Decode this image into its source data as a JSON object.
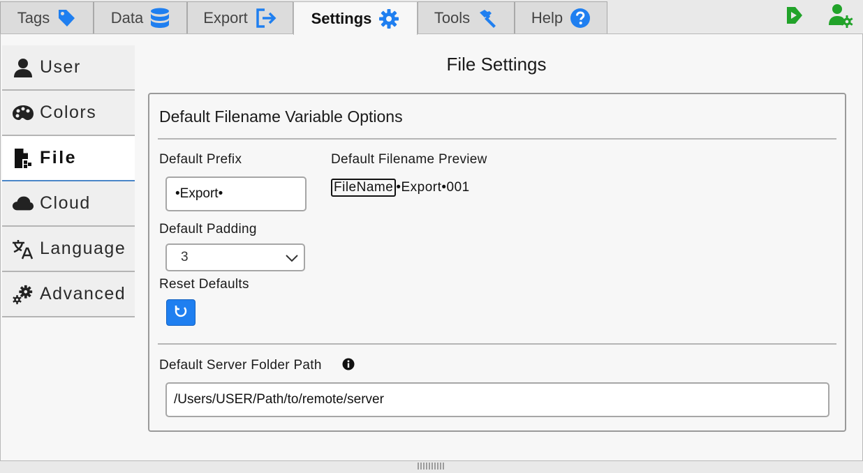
{
  "tabs": [
    {
      "label": "Tags",
      "icon": "tag-icon"
    },
    {
      "label": "Data",
      "icon": "database-icon"
    },
    {
      "label": "Export",
      "icon": "export-icon"
    },
    {
      "label": "Settings",
      "icon": "gear-icon",
      "active": true
    },
    {
      "label": "Tools",
      "icon": "hammer-icon"
    },
    {
      "label": "Help",
      "icon": "question-circle-icon"
    }
  ],
  "sidebar": {
    "items": [
      {
        "label": "User",
        "icon": "user-icon"
      },
      {
        "label": "Colors",
        "icon": "palette-icon"
      },
      {
        "label": "File",
        "icon": "file-icon",
        "active": true
      },
      {
        "label": "Cloud",
        "icon": "cloud-icon"
      },
      {
        "label": "Language",
        "icon": "language-icon"
      },
      {
        "label": "Advanced",
        "icon": "cogs-icon"
      }
    ]
  },
  "page": {
    "title": "File Settings"
  },
  "card": {
    "title": "Default Filename Variable Options",
    "prefix_label": "Default Prefix",
    "prefix_value": "•Export•",
    "padding_label": "Default Padding",
    "padding_value": "3",
    "reset_label": "Reset Defaults",
    "preview_label": "Default Filename Preview",
    "preview_chip": "FileName",
    "preview_rest": "•Export•001",
    "server_label": "Default Server Folder Path",
    "server_value": "/Users/USER/Path/to/remote/server"
  },
  "colors": {
    "accent": "#1f7ff0",
    "green_icons": "#22a32a"
  }
}
